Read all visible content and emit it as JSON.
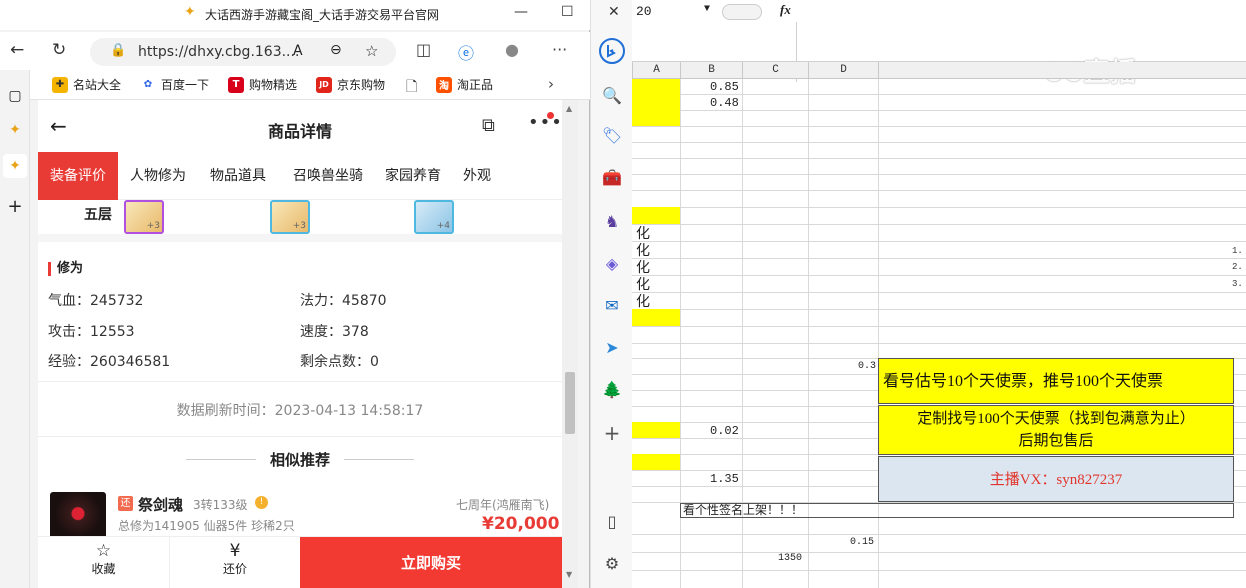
{
  "browser": {
    "window_title": "大话西游手游藏宝阁_大话手游交易平台官网",
    "url": "https://dhxy.cbg.163....",
    "bookmarks": [
      "名站大全",
      "百度一下",
      "购物精选",
      "京东购物",
      "淘正品"
    ]
  },
  "page": {
    "title": "商品详情",
    "tabs": [
      "装备评价",
      "人物修为",
      "物品道具",
      "召唤兽坐骑",
      "家园养育",
      "外观"
    ],
    "active_tab": "装备评价",
    "tier_label": "五层",
    "tier_items": [
      "+3",
      "+3",
      "+4"
    ],
    "cultivation": {
      "heading": "修为",
      "attrs": [
        {
          "label": "气血：245732"
        },
        {
          "label": "法力：45870"
        },
        {
          "label": "攻击：12553"
        },
        {
          "label": "速度：378"
        },
        {
          "label": "经验：260346581"
        },
        {
          "label": "剩余点数：0"
        }
      ]
    },
    "refresh_time": "数据刷新时间：2023-04-13 14:58:17",
    "similar_heading": "相似推荐",
    "recommendation": {
      "badge": "还",
      "name": "祭剑魂",
      "level": "3转133级",
      "server": "七周年(鸿雁南飞)",
      "stats": "总修为141905  仙器5件  珍稀2只",
      "price": "¥20,000"
    },
    "bottom": {
      "favorite": "收藏",
      "bargain": "还价",
      "buy": "立即购买"
    }
  },
  "spreadsheet": {
    "namebox": "20",
    "fx": "fx",
    "columns": [
      "A",
      "B",
      "C",
      "D"
    ],
    "values": {
      "b1": "0.85",
      "b2": "0.48",
      "d_small": "0.3",
      "b_mid": "0.02",
      "b_low": "1.35",
      "d_bottom": "0.15",
      "c_bottom": "1350"
    },
    "vertical_chars": [
      "化",
      "化",
      "化",
      "化",
      "化"
    ],
    "banner1": "看号估号10个天使票，推号100个天使票",
    "banner2_line1": "定制找号100个天使票（找到包满意为止）",
    "banner2_line2": "后期包售后",
    "banner3": "主播VX：syn827237",
    "signature": "看个性签名上架！！！",
    "row_nums": [
      "1.",
      "2.",
      "3."
    ],
    "watermark": "CC直播"
  }
}
